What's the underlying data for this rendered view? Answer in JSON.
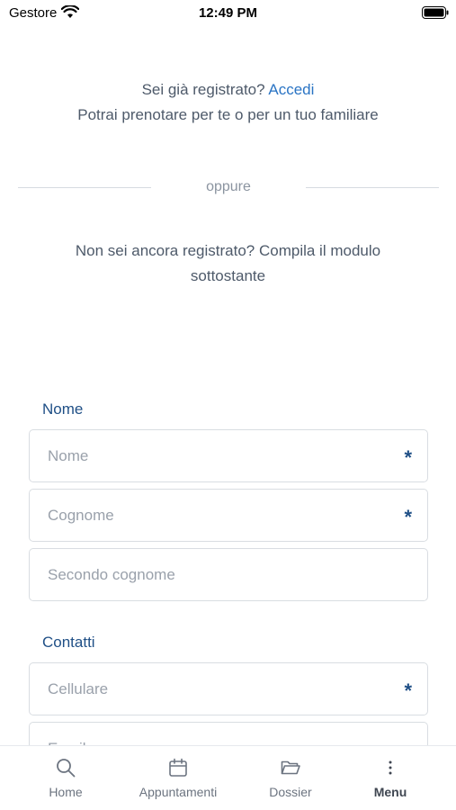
{
  "status_bar": {
    "carrier": "Gestore",
    "time": "12:49 PM"
  },
  "login": {
    "prompt": "Sei già registrato?",
    "link": "Accedi",
    "subtitle": "Potrai prenotare per te o per un tuo familiare"
  },
  "divider": {
    "text": "oppure"
  },
  "register": {
    "text": "Non sei ancora registrato? Compila il modulo sottostante"
  },
  "form": {
    "section_name": "Nome",
    "section_contacts": "Contatti",
    "fields": {
      "nome": {
        "placeholder": "Nome",
        "required": "*"
      },
      "cognome": {
        "placeholder": "Cognome",
        "required": "*"
      },
      "secondo_cognome": {
        "placeholder": "Secondo cognome"
      },
      "cellulare": {
        "placeholder": "Cellulare",
        "required": "*"
      },
      "email": {
        "placeholder": "Email"
      }
    }
  },
  "tabbar": {
    "items": [
      {
        "label": "Home",
        "icon": "search-icon"
      },
      {
        "label": "Appuntamenti",
        "icon": "calendar-icon"
      },
      {
        "label": "Dossier",
        "icon": "folder-icon"
      },
      {
        "label": "Menu",
        "icon": "more-vertical-icon",
        "active": true
      }
    ]
  }
}
